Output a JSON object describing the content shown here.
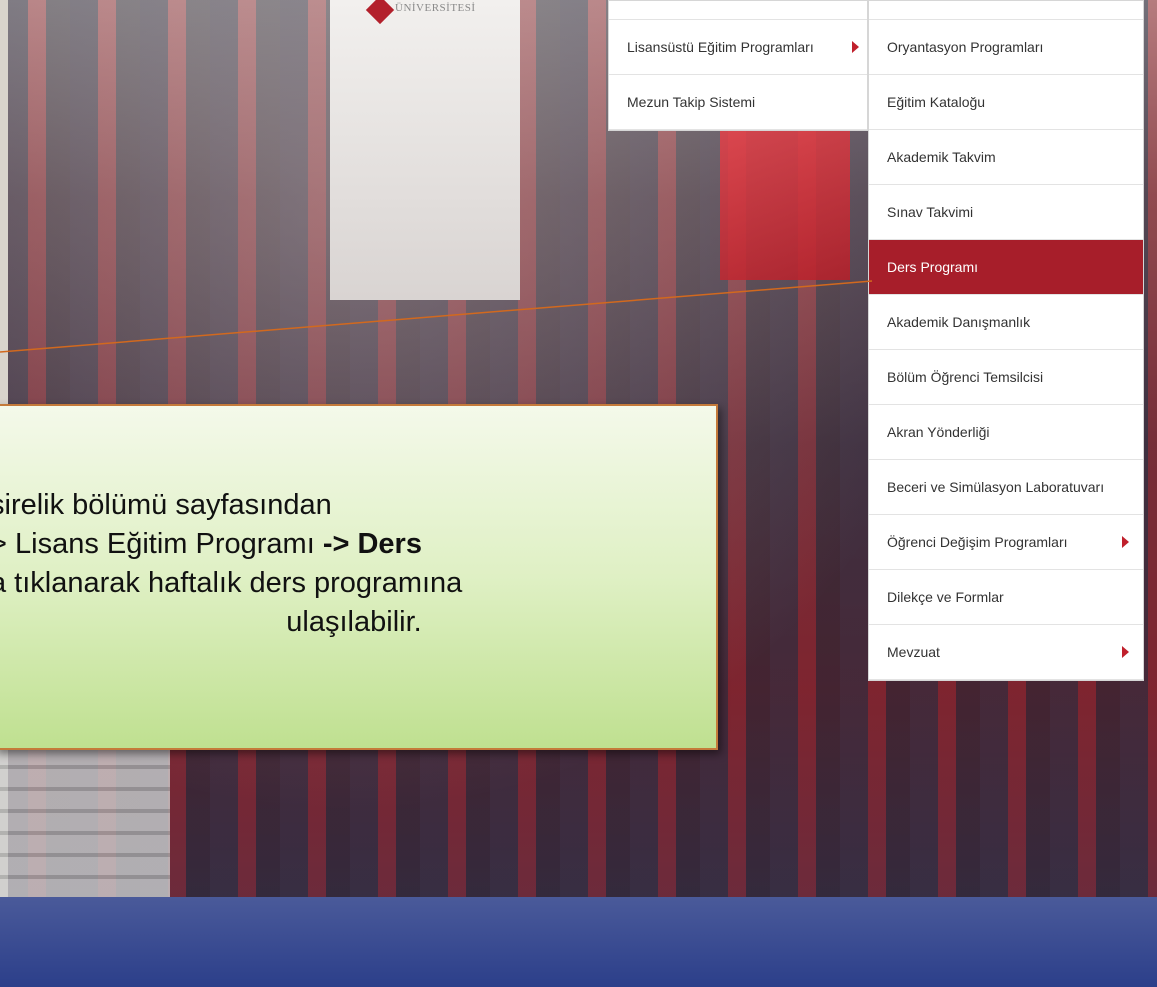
{
  "banner": {
    "logo_text": "ÜNİVERSİTESİ"
  },
  "menu_primary": {
    "items": [
      {
        "label": "",
        "has_submenu": false
      },
      {
        "label": "Lisansüstü Eğitim Programları",
        "has_submenu": true
      },
      {
        "label": "Mezun Takip Sistemi",
        "has_submenu": false
      }
    ]
  },
  "menu_secondary": {
    "items": [
      {
        "label": "",
        "has_submenu": false,
        "active": false
      },
      {
        "label": "Oryantasyon Programları",
        "has_submenu": false,
        "active": false
      },
      {
        "label": "Eğitim Kataloğu",
        "has_submenu": false,
        "active": false
      },
      {
        "label": "Akademik Takvim",
        "has_submenu": false,
        "active": false
      },
      {
        "label": "Sınav Takvimi",
        "has_submenu": false,
        "active": false
      },
      {
        "label": "Ders Programı",
        "has_submenu": false,
        "active": true
      },
      {
        "label": "Akademik Danışmanlık",
        "has_submenu": false,
        "active": false
      },
      {
        "label": "Bölüm Öğrenci Temsilcisi",
        "has_submenu": false,
        "active": false
      },
      {
        "label": "Akran Yönderliği",
        "has_submenu": false,
        "active": false
      },
      {
        "label": "Beceri ve Simülasyon Laboratuvarı",
        "has_submenu": false,
        "active": false
      },
      {
        "label": "Öğrenci Değişim Programları",
        "has_submenu": true,
        "active": false
      },
      {
        "label": "Dilekçe ve Formlar",
        "has_submenu": false,
        "active": false
      },
      {
        "label": "Mevzuat",
        "has_submenu": true,
        "active": false
      }
    ]
  },
  "callout": {
    "line1": "şirelik bölümü sayfasından",
    "line2_pre": "> Lisans Eğitim Programı ",
    "line2_bold": "-> Ders",
    "line3": "a tıklanarak haftalık ders programına",
    "line4": "ulaşılabilir."
  },
  "colors": {
    "active_item": "#a71e2a",
    "arrow": "#c0202c",
    "callout_border": "#c47a3a",
    "pointer_line": "#d2691e"
  }
}
